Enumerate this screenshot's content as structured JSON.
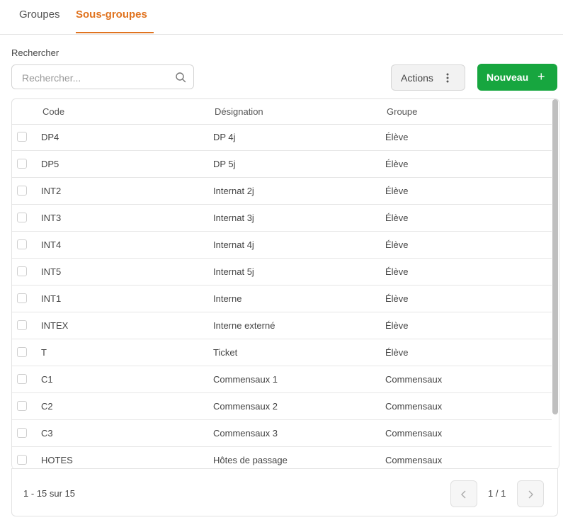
{
  "tabs": [
    {
      "label": "Groupes",
      "active": false
    },
    {
      "label": "Sous-groupes",
      "active": true
    }
  ],
  "colors": {
    "accent": "#e0731f",
    "primary_button": "#17a63f"
  },
  "search": {
    "label": "Rechercher",
    "placeholder": "Rechercher...",
    "value": "",
    "icon": "search-icon"
  },
  "toolbar": {
    "actions_label": "Actions",
    "actions_icon": "kebab-icon",
    "new_label": "Nouveau",
    "new_icon": "+"
  },
  "table": {
    "headers": [
      "Code",
      "Désignation",
      "Groupe"
    ],
    "rows": [
      {
        "code": "DP4",
        "designation": "DP 4j",
        "groupe": "Élève"
      },
      {
        "code": "DP5",
        "designation": "DP 5j",
        "groupe": "Élève"
      },
      {
        "code": "INT2",
        "designation": "Internat 2j",
        "groupe": "Élève"
      },
      {
        "code": "INT3",
        "designation": "Internat 3j",
        "groupe": "Élève"
      },
      {
        "code": "INT4",
        "designation": "Internat 4j",
        "groupe": "Élève"
      },
      {
        "code": "INT5",
        "designation": "Internat 5j",
        "groupe": "Élève"
      },
      {
        "code": "INT1",
        "designation": "Interne",
        "groupe": "Élève"
      },
      {
        "code": "INTEX",
        "designation": "Interne externé",
        "groupe": "Élève"
      },
      {
        "code": "T",
        "designation": "Ticket",
        "groupe": "Élève"
      },
      {
        "code": "C1",
        "designation": "Commensaux 1",
        "groupe": "Commensaux"
      },
      {
        "code": "C2",
        "designation": "Commensaux 2",
        "groupe": "Commensaux"
      },
      {
        "code": "C3",
        "designation": "Commensaux 3",
        "groupe": "Commensaux"
      },
      {
        "code": "HOTES",
        "designation": "Hôtes de passage",
        "groupe": "Commensaux"
      }
    ]
  },
  "pagination": {
    "range_text": "1 - 15 sur 15",
    "page_indicator": "1 / 1",
    "prev_icon": "chevron-left-icon",
    "next_icon": "chevron-right-icon"
  }
}
